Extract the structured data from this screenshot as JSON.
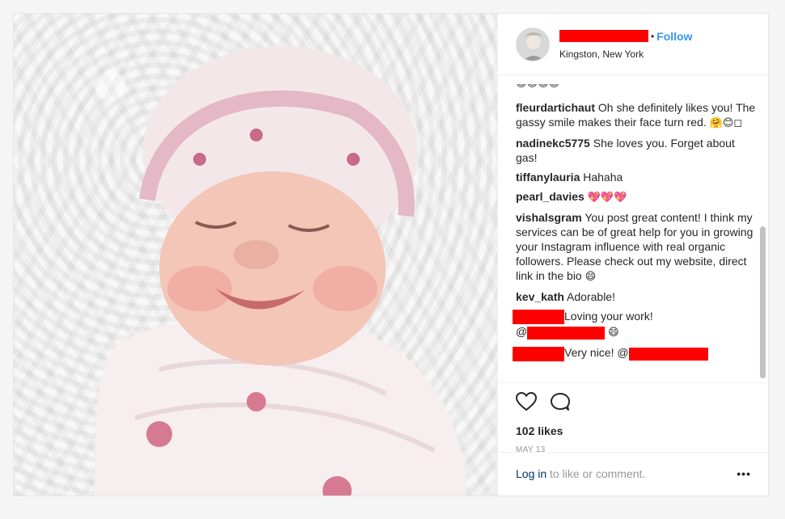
{
  "header": {
    "follow_label": "Follow",
    "separator": "•",
    "location": "Kingston, New York"
  },
  "comments": [
    {
      "user": "",
      "text": "",
      "emoji": "😊😊😊😊"
    },
    {
      "user": "fleurdartichaut",
      "text": " Oh she definitely likes you! The gassy smile makes their face turn red. ",
      "emoji": "🤗😊◻"
    },
    {
      "user": "nadinekc5775",
      "text": " She loves you. Forget about gas!",
      "emoji": ""
    },
    {
      "user": "tiffanylauria",
      "text": " Hahaha",
      "emoji": ""
    },
    {
      "user": "pearl_davies",
      "text": " ",
      "emoji": "💖💖💖"
    },
    {
      "user": "vishalsgram",
      "text": " You post great content! I think my services can be of great help for you in growing your Instagram influence with real organic followers. Please check out my website, direct link in the bio ",
      "emoji": "😄"
    },
    {
      "user": "kev_kath",
      "text": " Adorable!",
      "emoji": ""
    },
    {
      "user": "",
      "text": "Loving your work!",
      "mention_prefix": "@",
      "emoji": "😄"
    },
    {
      "user": "",
      "text": "Very nice! @",
      "emoji": ""
    }
  ],
  "actions": {
    "likes": "102 likes",
    "date": "MAY 13"
  },
  "footer": {
    "login": "Log in",
    "rest": " to like or comment.",
    "more": "•••"
  },
  "icons": [
    "heart-icon",
    "comment-icon",
    "more-options-icon"
  ],
  "colors": {
    "accent": "#3897f0",
    "redaction": "#ff0000"
  }
}
